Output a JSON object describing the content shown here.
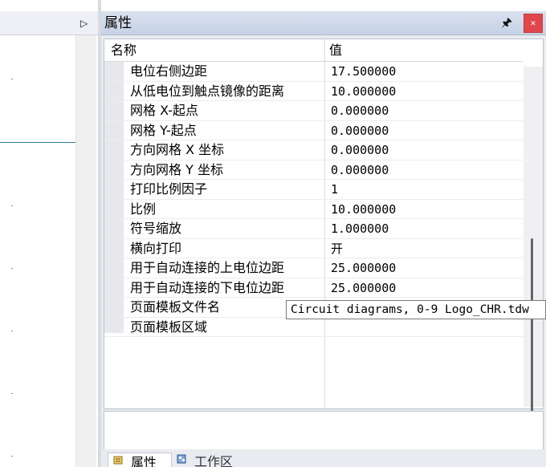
{
  "props_panel": {
    "title": "属性",
    "header": {
      "name": "名称",
      "value": "值"
    },
    "rows": [
      {
        "name": "电位右侧边距",
        "value": "17.500000"
      },
      {
        "name": "从低电位到触点镜像的距离",
        "value": "10.000000"
      },
      {
        "name": "网格 X-起点",
        "value": "0.000000"
      },
      {
        "name": "网格 Y-起点",
        "value": "0.000000"
      },
      {
        "name": "方向网格 X 坐标",
        "value": "0.000000"
      },
      {
        "name": "方向网格 Y 坐标",
        "value": "0.000000"
      },
      {
        "name": "打印比例因子",
        "value": "1"
      },
      {
        "name": "比例",
        "value": "10.000000"
      },
      {
        "name": "符号缩放",
        "value": "1.000000"
      },
      {
        "name": "横向打印",
        "value": "开"
      },
      {
        "name": "用于自动连接的上电位边距",
        "value": "25.000000"
      },
      {
        "name": "用于自动连接的下电位边距",
        "value": "25.000000"
      },
      {
        "name": "页面模板文件名",
        "value": ""
      },
      {
        "name": "页面模板区域",
        "value": ""
      }
    ],
    "tooltip": "Circuit diagrams, 0-9 Logo_CHR.tdw"
  },
  "tabs": [
    {
      "label": "属性",
      "icon": "properties-tab-icon"
    },
    {
      "label": "工作区",
      "icon": "workspace-tab-icon"
    }
  ],
  "icons": {
    "pin": "pin-icon",
    "close": "close-icon",
    "expand": "expand-arrow-icon"
  },
  "colors": {
    "close_button": "#e0474c",
    "title_bar": "#c6d2e6",
    "left_divider": "#2f7f9e"
  }
}
